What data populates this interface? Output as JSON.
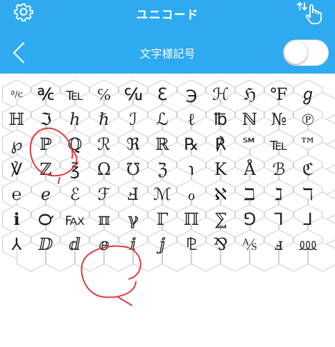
{
  "app_title": "ユニコード",
  "page_title": "文字様記号",
  "icons": {
    "settings": "gear-icon",
    "touch": "touch-swipe-icon",
    "back": "chevron-left-icon"
  },
  "toggle": {
    "state": "off"
  },
  "colors": {
    "header": "#2eaaf0",
    "hex_border": "#d2d2d2",
    "annotation": "#e0393e",
    "text": "#1e1e1e"
  },
  "symbols": [
    [
      "ª/c",
      "℀",
      "℡",
      "℅",
      "℆",
      "ℇ",
      "℈",
      "ℋ",
      "ℌ",
      "℉",
      "ℊ"
    ],
    [
      "ℍ",
      "ℑ",
      "ℎ",
      "ℏ",
      "ℐ",
      "ℒ",
      "ℓ",
      "℔",
      "ℕ",
      "№",
      "℗"
    ],
    [
      "℘",
      "ℙ",
      "ℚ",
      "ℛ",
      "ℜ",
      "ℝ",
      "℞",
      "℟",
      "℠",
      "℡",
      "™"
    ],
    [
      "℣",
      "ℤ",
      "℥",
      "Ω",
      "℧",
      "ℨ",
      "℩",
      "K",
      "Å",
      "ℬ",
      "ℭ"
    ],
    [
      "℮",
      "ℯ",
      "ℰ",
      "ℱ",
      "Ⅎ",
      "ℳ",
      "ℴ",
      "ℵ",
      "ℶ",
      "ℷ",
      "ℸ"
    ],
    [
      "ℹ",
      "℺",
      "℻",
      "ℼ",
      "ℽ",
      "ℾ",
      "ℿ",
      "⅀",
      "⅁",
      "⅂",
      "⅃"
    ],
    [
      "⅄",
      "ⅅ",
      "ⅆ",
      "ⅇ",
      "ⅈ",
      "ⅉ",
      "⅊",
      "⅋",
      "⅍",
      "ⅎ",
      "⅏"
    ]
  ]
}
